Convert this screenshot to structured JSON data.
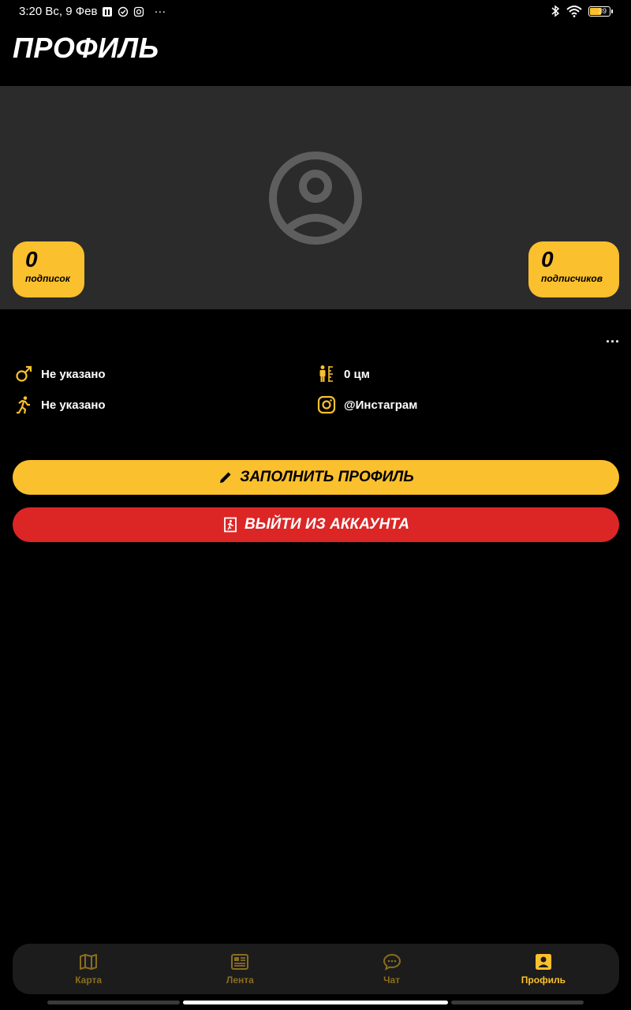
{
  "status_bar": {
    "time_date": "3:20 Вс, 9 Фев",
    "dots": "···",
    "battery_level": "39"
  },
  "page_title": "ПРОФИЛЬ",
  "stats": {
    "following_count": "0",
    "following_label": "подписок",
    "followers_count": "0",
    "followers_label": "подписчиков"
  },
  "more_label": "···",
  "info": {
    "gender": "Не указано",
    "height": "0 цм",
    "activity": "Не указано",
    "instagram": "@Инстаграм"
  },
  "buttons": {
    "fill_profile": "ЗАПОЛНИТЬ ПРОФИЛЬ",
    "logout": "ВЫЙТИ ИЗ АККАУНТА"
  },
  "nav": {
    "items": [
      {
        "label": "Карта",
        "icon": "map-icon",
        "active": false
      },
      {
        "label": "Лента",
        "icon": "newspaper-icon",
        "active": false
      },
      {
        "label": "Чат",
        "icon": "chat-icon",
        "active": false
      },
      {
        "label": "Профиль",
        "icon": "profile-card-icon",
        "active": true
      }
    ]
  },
  "colors": {
    "accent": "#fbc02d",
    "danger": "#dc2626",
    "hero_bg": "#2b2b2b",
    "nav_bg": "#1c1c1c",
    "nav_inactive": "#8a6d1e"
  }
}
